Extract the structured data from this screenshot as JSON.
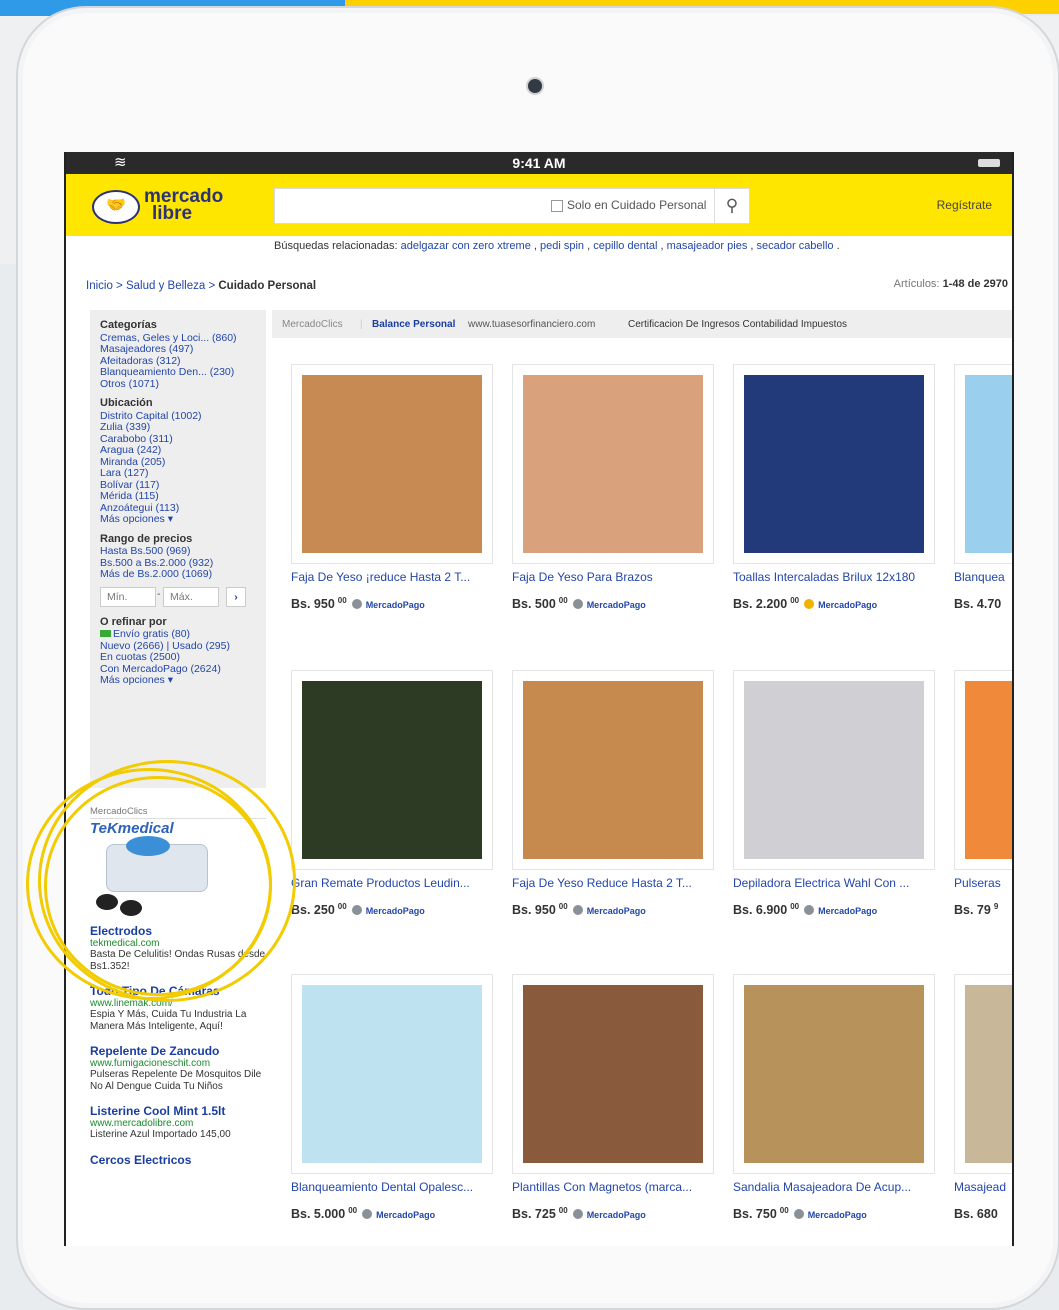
{
  "status": {
    "time": "9:41 AM"
  },
  "header": {
    "logo_line1": "mercado",
    "logo_line2": "libre",
    "search_value": "",
    "search_option": "Solo en Cuidado Personal",
    "register": "Regístrate"
  },
  "related": {
    "label": "Búsquedas relacionadas:",
    "links": [
      "adelgazar con zero xtreme",
      "pedi spin",
      "cepillo dental",
      "masajeador pies",
      "secador cabello"
    ]
  },
  "breadcrumb": {
    "parts": [
      "Inicio",
      "Salud y Belleza"
    ],
    "current": "Cuidado Personal",
    "sep": " > "
  },
  "results": {
    "label": "Artículos:",
    "value": "1-48 de 2970"
  },
  "sidebar": {
    "categories_title": "Categorías",
    "categories": [
      "Cremas, Geles y Loci... (860)",
      "Masajeadores (497)",
      "Afeitadoras (312)",
      "Blanqueamiento Den... (230)",
      "Otros (1071)"
    ],
    "location_title": "Ubicación",
    "locations": [
      "Distrito Capital (1002)",
      "Zulia (339)",
      "Carabobo (311)",
      "Aragua (242)",
      "Miranda (205)",
      "Lara (127)",
      "Bolívar (117)",
      "Mérida (115)",
      "Anzoátegui (113)"
    ],
    "more": "Más opciones ▾",
    "price_title": "Rango de precios",
    "prices": [
      "Hasta Bs.500 (969)",
      "Bs.500 a Bs.2.000 (932)",
      "Más de Bs.2.000 (1069)"
    ],
    "min_placeholder": "Mín.",
    "max_placeholder": "Máx.",
    "refine_title": "O refinar por",
    "refine": [
      "Envío gratis (80)",
      "Nuevo (2666) | Usado (295)",
      "En cuotas (2500)",
      "Con MercadoPago (2624)"
    ],
    "refine_more": "Más opciones ▾"
  },
  "ads": {
    "label": "MercadoClics",
    "brand": "TeKmedical",
    "items": [
      {
        "title": "Electrodos",
        "url": "tekmedical.com",
        "desc": "Basta De Celulitis! Ondas Rusas desde Bs1.352!"
      },
      {
        "title": "Todo Tipo De Cámaras",
        "url": "www.linemak.com/",
        "desc": "Espia Y Más, Cuida Tu Industria La Manera Más Inteligente, Aquí!"
      },
      {
        "title": "Repelente De Zancudo",
        "url": "www.fumigacioneschit.com",
        "desc": "Pulseras Repelente De Mosquitos Dile No Al Dengue Cuida Tu Niños"
      },
      {
        "title": "Listerine Cool Mint 1.5lt",
        "url": "www.mercadolibre.com",
        "desc": "Listerine Azul Importado 145,00"
      },
      {
        "title": "Cercos Electricos",
        "url": "",
        "desc": ""
      }
    ]
  },
  "topad": {
    "label": "MercadoClics",
    "title": "Balance Personal",
    "url": "www.tuasesorfinanciero.com",
    "desc": "Certificacion De Ingresos Contabilidad Impuestos"
  },
  "products": [
    {
      "title": "Faja De Yeso ¡reduce Hasta 2 T...",
      "price": "Bs. 950",
      "cents": "00",
      "pay": "MercadoPago",
      "color": "#c78a52"
    },
    {
      "title": "Faja De Yeso Para Brazos",
      "price": "Bs. 500",
      "cents": "00",
      "pay": "MercadoPago",
      "color": "#d9a27c"
    },
    {
      "title": "Toallas Intercaladas Brilux 12x180",
      "price": "Bs. 2.200",
      "cents": "00",
      "pay": "MercadoPago",
      "color": "#233a7a"
    },
    {
      "title": "Blanquea",
      "price": "Bs. 4.70",
      "cents": "",
      "pay": "",
      "color": "#9ad0ee"
    },
    {
      "title": "Gran Remate Productos Leudin...",
      "price": "Bs. 250",
      "cents": "00",
      "pay": "MercadoPago",
      "color": "#2e3b24"
    },
    {
      "title": "Faja De Yeso Reduce Hasta 2 T...",
      "price": "Bs. 950",
      "cents": "00",
      "pay": "MercadoPago",
      "color": "#c68a4f"
    },
    {
      "title": "Depiladora Electrica Wahl Con ...",
      "price": "Bs. 6.900",
      "cents": "00",
      "pay": "MercadoPago",
      "color": "#cfcfd4"
    },
    {
      "title": "Pulseras",
      "price": "Bs. 79",
      "cents": "9",
      "pay": "",
      "color": "#f08a3a"
    },
    {
      "title": "Blanqueamiento Dental Opalesc...",
      "price": "Bs. 5.000",
      "cents": "00",
      "pay": "MercadoPago",
      "color": "#bfe2f1"
    },
    {
      "title": "Plantillas Con Magnetos (marca...",
      "price": "Bs. 725",
      "cents": "00",
      "pay": "MercadoPago",
      "color": "#8a5a3c"
    },
    {
      "title": "Sandalia Masajeadora De Acup...",
      "price": "Bs. 750",
      "cents": "00",
      "pay": "MercadoPago",
      "color": "#b7925a"
    },
    {
      "title": "Masajead",
      "price": "Bs. 680",
      "cents": "",
      "pay": "",
      "color": "#c9b79a"
    }
  ]
}
